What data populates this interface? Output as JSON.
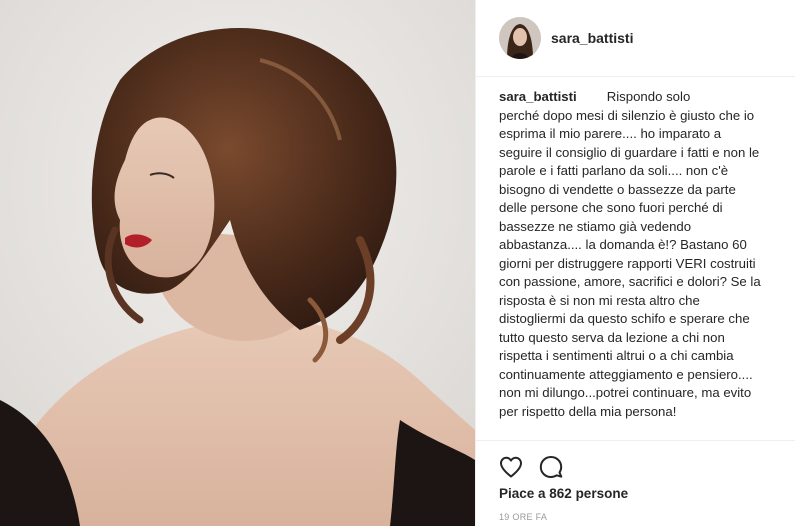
{
  "post": {
    "username": "sara_battisti",
    "caption_text": "Rispondo solo\nperché dopo mesi di silenzio è giusto che io esprima il mio parere.... ho imparato a seguire il consiglio di guardare i fatti e non le parole e i fatti parlano da soli.... non c'è bisogno di vendette o bassezze da parte delle persone che sono fuori perché di bassezze ne stiamo già vedendo abbastanza.... la domanda è!? Bastano 60 giorni per distruggere rapporti VERI costruiti con passione, amore, sacrifici e dolori? Se la risposta è si non mi resta altro che distogliermi da questo schifo e sperare che tutto questo serva da lezione a chi non rispetta i sentimenti altrui o a chi cambia continuamente atteggiamento e pensiero.... non mi dilungo...potrei continuare, ma evito per rispetto della mia persona!",
    "likes_text": "Piace a 862 persone",
    "time_text": "19 ORE FA"
  },
  "icons": {
    "like": "heart-icon",
    "comment": "comment-icon"
  },
  "colors": {
    "text": "#262626",
    "muted": "#999999",
    "divider": "#efefef"
  }
}
